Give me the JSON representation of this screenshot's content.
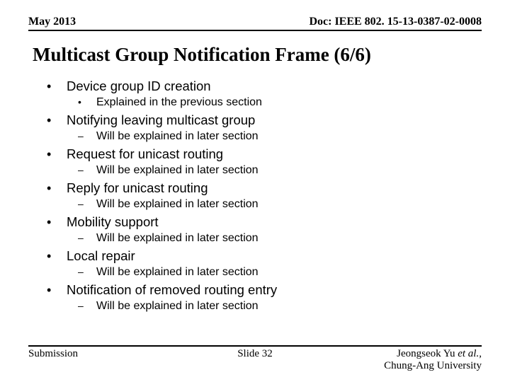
{
  "header": {
    "date": "May 2013",
    "doc": "Doc: IEEE 802. 15-13-0387-02-0008"
  },
  "title": "Multicast Group Notification Frame (6/6)",
  "bullets": [
    {
      "text": "Device group ID creation",
      "sub_style": "dot",
      "sub": [
        "Explained in the previous section"
      ]
    },
    {
      "text": "Notifying leaving multicast group",
      "sub_style": "dash",
      "sub": [
        "Will be explained in later section"
      ]
    },
    {
      "text": "Request for unicast routing",
      "sub_style": "dash",
      "sub": [
        "Will be explained in later section"
      ]
    },
    {
      "text": "Reply for unicast routing",
      "sub_style": "dash",
      "sub": [
        "Will be explained in later section"
      ]
    },
    {
      "text": "Mobility support",
      "sub_style": "dash",
      "sub": [
        "Will be explained in later section"
      ]
    },
    {
      "text": "Local repair",
      "sub_style": "dash",
      "sub": [
        "Will be explained in later section"
      ]
    },
    {
      "text": "Notification of removed routing entry",
      "sub_style": "dash",
      "sub": [
        "Will be explained in later section"
      ]
    }
  ],
  "footer": {
    "left": "Submission",
    "center": "Slide 32",
    "right_name": "Jeongseok Yu",
    "right_etal": " et al.",
    "right_suffix": ",",
    "right_affil": "Chung-Ang University"
  }
}
